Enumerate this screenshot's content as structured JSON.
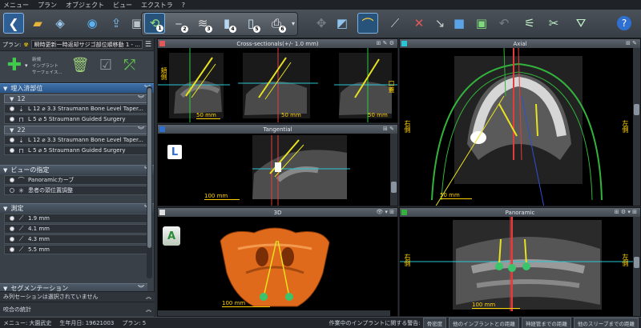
{
  "menu": [
    "メニュー",
    "プラン",
    "オブジェクト",
    "ビュー",
    "エクストラ",
    "?"
  ],
  "left_panel": {
    "plan_label": "プラン:",
    "plan_name": "瞬時更新一時返却サジゴ部位順移動 1 - ...",
    "tools_text_1": "新規",
    "tools_text_2": "インプラント",
    "tools_text_3": "サーフェイス...",
    "section_implants": "埋入済部位",
    "implant_groups": [
      {
        "label": "12",
        "items": [
          {
            "text": "L 12 ⌀ 3.3   Straumann Bone Level Taper..."
          },
          {
            "text": "L 5 ⌀ 5   Straumann Guided Surgery"
          }
        ]
      },
      {
        "label": "22",
        "items": [
          {
            "text": "L 12 ⌀ 3.3   Straumann Bone Level Taper..."
          },
          {
            "text": "L 5 ⌀ 5   Straumann Guided Surgery"
          }
        ]
      }
    ],
    "section_view": "ビューの指定",
    "view_items": [
      "Panoramicカーブ",
      "患者の頭位置調整"
    ],
    "section_measure": "測定",
    "measure_items": [
      "1.9 mm",
      "4.1 mm",
      "4.3 mm",
      "5.5 mm"
    ],
    "section_segment": "セグメンテーション",
    "segment_status": "み列セーションは選択されていません",
    "stats_label": "咬合の統計"
  },
  "viewports": {
    "cross_title": "Cross-sectionals(+/- 1.0 mm)",
    "axial_title": "Axial",
    "tangential_title": "Tangential",
    "panoramic_title": "Panoramic",
    "d3_title": "3D",
    "scale_50": "50 mm",
    "scale_100": "100 mm",
    "side_left_jp": "頬側",
    "side_right_jp": "口蓋",
    "axial_right": "右側",
    "axial_left": "左側",
    "pano_right": "右側",
    "pano_left": "左側",
    "tang_letter": "L",
    "cube_letter": "A"
  },
  "statusbar": {
    "menu_label": "メニュー:",
    "patient_name": "大園武史",
    "dob_label": "生年月日:",
    "dob": "19621003",
    "plan_label": "プラン:",
    "plan_no": "5",
    "message": "作業中のインプラントに関する警告:",
    "chip_1": "骨密度",
    "chip_2": "他のインプラントとの距離",
    "chip_3": "神経管までの距離",
    "chip_4": "他のスリーブまでの距離"
  },
  "colors": {
    "accent": "#3d6fa6",
    "yellow": "#ffd000",
    "red_sq": "#e25757",
    "cyan_sq": "#29c6d6",
    "blue_sq": "#2f6fd0",
    "green_sq": "#32b43c"
  }
}
